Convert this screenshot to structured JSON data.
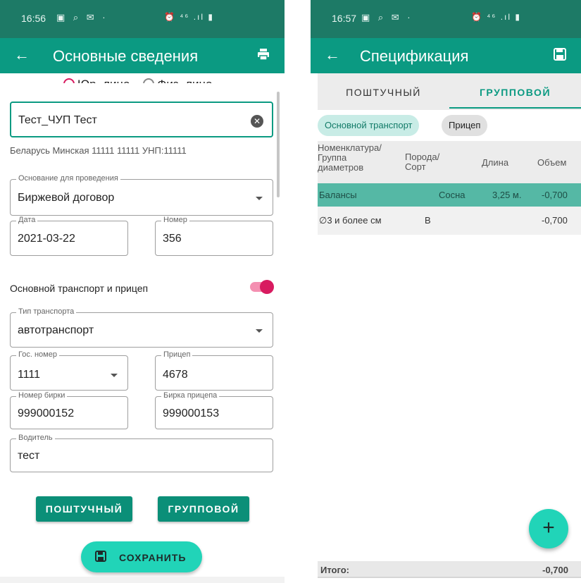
{
  "colors": {
    "status_bar": "#1d7a66",
    "app_bar": "#0b9a82",
    "accent": "#21d4b8",
    "toggle_accent": "#d81b60",
    "selected_row": "#55b8a5"
  },
  "left": {
    "status": {
      "time": "16:56",
      "left_icons": "▣ ⌕ ✉ ·",
      "right_icons": "⏰ ⁴⁶ .ıl ▮"
    },
    "appbar": {
      "back_icon": "←",
      "title": "Основные сведения",
      "action_icon": "print-icon"
    },
    "radios": {
      "legal": "Юр. лицо",
      "physical": "Физ. лицо",
      "selected": "legal"
    },
    "sender": {
      "value": "Тест_ЧУП  Тест",
      "clear_icon": "✕"
    },
    "sender_details": "Беларусь Минская 11111 11111 УНП:11111",
    "basis": {
      "label": "Основание для проведения",
      "value": "Биржевой договор"
    },
    "date": {
      "label": "Дата",
      "value": "2021-03-22"
    },
    "number": {
      "label": "Номер",
      "value": "356"
    },
    "transport_section": {
      "label": "Основной транспорт и прицеп",
      "toggle_on": true
    },
    "transport_type": {
      "label": "Тип транспорта",
      "value": "автотранспорт"
    },
    "gov_number": {
      "label": "Гос. номер",
      "value": "1111"
    },
    "trailer": {
      "label": "Прицеп",
      "value": "4678"
    },
    "tag_number": {
      "label": "Номер бирки",
      "value": "999000152"
    },
    "trailer_tag": {
      "label": "Бирка прицепа",
      "value": "999000153"
    },
    "driver": {
      "label": "Водитель",
      "value": "тест"
    },
    "buttons": {
      "piece": "ПОШТУЧНЫЙ",
      "group": "ГРУППОВОЙ",
      "save": "СОХРАНИТЬ"
    }
  },
  "right": {
    "status": {
      "time": "16:57",
      "left_icons": "▣ ⌕ ✉ ·",
      "right_icons": "⏰ ⁴⁶ .ıl ▮"
    },
    "appbar": {
      "back_icon": "←",
      "title": "Спецификация",
      "action_icon": "save-icon"
    },
    "tabs": {
      "piece": "ПОШТУЧНЫЙ",
      "group": "ГРУППОВОЙ",
      "active": "group"
    },
    "chips": {
      "main": "Основной транспорт",
      "trailer": "Прицеп",
      "active": "main"
    },
    "table": {
      "headers": {
        "nomenclature_1": "Номенклатура/",
        "nomenclature_2": "Группа",
        "nomenclature_3": "диаметров",
        "species_1": "Порода/",
        "species_2": "Сорт",
        "length": "Длина",
        "volume": "Объем"
      },
      "rows": [
        {
          "name": "Балансы",
          "species": "Сосна",
          "length": "3,25 м.",
          "volume": "-0,700"
        },
        {
          "name": "∅3 и более см",
          "species": "В",
          "length": "",
          "volume": "-0,700"
        }
      ]
    },
    "fab_icon": "+",
    "total": {
      "label": "Итого:",
      "value": "-0,700"
    }
  }
}
